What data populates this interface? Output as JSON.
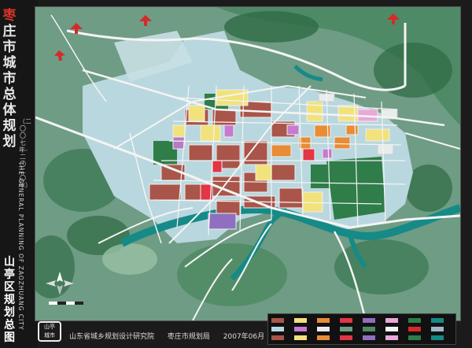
{
  "title": {
    "first_char": "枣",
    "rest": "庄市城市总体规划",
    "years": "（二〇〇七年-二〇二〇年）",
    "english": "THE GENERAL PLANNING OF ZAOZHUANG CITY",
    "district": "山亭区规划总图"
  },
  "seal_text": "山亭城市",
  "footer": {
    "institute": "山东省城乡规划设计研究院",
    "bureau": "枣庄市规划局",
    "date": "2007年06月"
  },
  "icons": [
    "arrow-up-icon",
    "north-arrow-icon"
  ],
  "colors": {
    "water": "#1a8a8a",
    "forest": "#2f7f4a",
    "hill": "#8fb89a",
    "plain": "#b8d6dc",
    "residential": "#a05040",
    "yellow": "#f2e07a",
    "orange": "#e88a30",
    "red": "#e03040",
    "purple": "#9070c0",
    "road": "#eeeeee"
  }
}
